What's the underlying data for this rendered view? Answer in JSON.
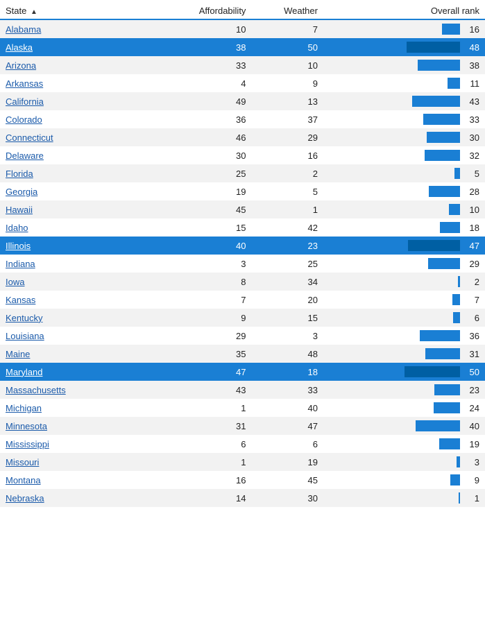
{
  "header": {
    "state_label": "State",
    "affordability_label": "Affordability",
    "weather_label": "Weather",
    "rank_label": "Overall rank",
    "sort_arrow": "▲"
  },
  "rows": [
    {
      "state": "Alabama",
      "affordability": 10,
      "weather": 7,
      "rank": 16,
      "highlight": false
    },
    {
      "state": "Alaska",
      "affordability": 38,
      "weather": 50,
      "rank": 48,
      "highlight": true
    },
    {
      "state": "Arizona",
      "affordability": 33,
      "weather": 10,
      "rank": 38,
      "highlight": false
    },
    {
      "state": "Arkansas",
      "affordability": 4,
      "weather": 9,
      "rank": 11,
      "highlight": false
    },
    {
      "state": "California",
      "affordability": 49,
      "weather": 13,
      "rank": 43,
      "highlight": false
    },
    {
      "state": "Colorado",
      "affordability": 36,
      "weather": 37,
      "rank": 33,
      "highlight": false
    },
    {
      "state": "Connecticut",
      "affordability": 46,
      "weather": 29,
      "rank": 30,
      "highlight": false
    },
    {
      "state": "Delaware",
      "affordability": 30,
      "weather": 16,
      "rank": 32,
      "highlight": false
    },
    {
      "state": "Florida",
      "affordability": 25,
      "weather": 2,
      "rank": 5,
      "highlight": false
    },
    {
      "state": "Georgia",
      "affordability": 19,
      "weather": 5,
      "rank": 28,
      "highlight": false
    },
    {
      "state": "Hawaii",
      "affordability": 45,
      "weather": 1,
      "rank": 10,
      "highlight": false
    },
    {
      "state": "Idaho",
      "affordability": 15,
      "weather": 42,
      "rank": 18,
      "highlight": false
    },
    {
      "state": "Illinois",
      "affordability": 40,
      "weather": 23,
      "rank": 47,
      "highlight": true
    },
    {
      "state": "Indiana",
      "affordability": 3,
      "weather": 25,
      "rank": 29,
      "highlight": false
    },
    {
      "state": "Iowa",
      "affordability": 8,
      "weather": 34,
      "rank": 2,
      "highlight": false
    },
    {
      "state": "Kansas",
      "affordability": 7,
      "weather": 20,
      "rank": 7,
      "highlight": false
    },
    {
      "state": "Kentucky",
      "affordability": 9,
      "weather": 15,
      "rank": 6,
      "highlight": false
    },
    {
      "state": "Louisiana",
      "affordability": 29,
      "weather": 3,
      "rank": 36,
      "highlight": false
    },
    {
      "state": "Maine",
      "affordability": 35,
      "weather": 48,
      "rank": 31,
      "highlight": false
    },
    {
      "state": "Maryland",
      "affordability": 47,
      "weather": 18,
      "rank": 50,
      "highlight": true
    },
    {
      "state": "Massachusetts",
      "affordability": 43,
      "weather": 33,
      "rank": 23,
      "highlight": false
    },
    {
      "state": "Michigan",
      "affordability": 1,
      "weather": 40,
      "rank": 24,
      "highlight": false
    },
    {
      "state": "Minnesota",
      "affordability": 31,
      "weather": 47,
      "rank": 40,
      "highlight": false
    },
    {
      "state": "Mississippi",
      "affordability": 6,
      "weather": 6,
      "rank": 19,
      "highlight": false
    },
    {
      "state": "Missouri",
      "affordability": 1,
      "weather": 19,
      "rank": 3,
      "highlight": false
    },
    {
      "state": "Montana",
      "affordability": 16,
      "weather": 45,
      "rank": 9,
      "highlight": false
    },
    {
      "state": "Nebraska",
      "affordability": 14,
      "weather": 30,
      "rank": 1,
      "highlight": false
    }
  ],
  "max_rank": 50,
  "bar_max_width": 80
}
